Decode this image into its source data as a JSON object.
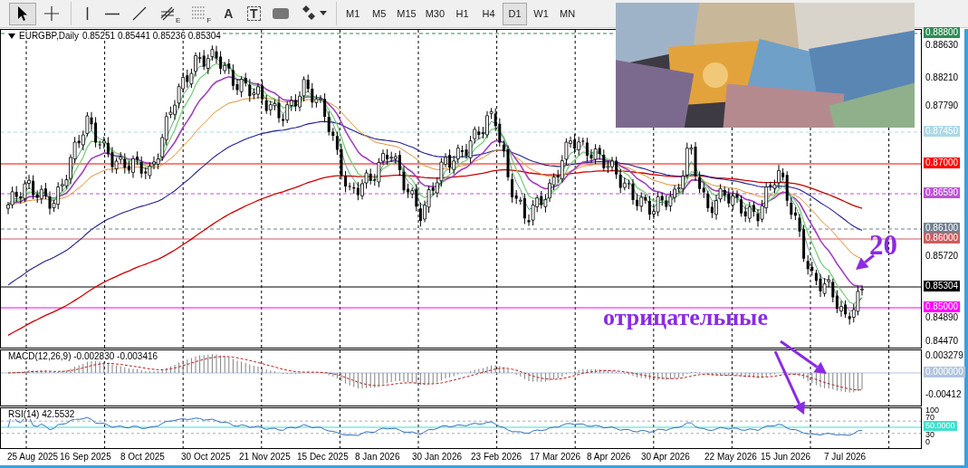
{
  "tools": [
    {
      "kind": "cursor",
      "selected": true
    },
    {
      "kind": "crosshair",
      "selected": false
    },
    {
      "kind": "vertical-line",
      "selected": false
    },
    {
      "kind": "horizontal-line",
      "selected": false
    },
    {
      "kind": "trend-line",
      "selected": false
    },
    {
      "kind": "fibonacci",
      "label": "E",
      "selected": false
    },
    {
      "kind": "fibonacci-levels",
      "label": "F",
      "selected": false
    },
    {
      "kind": "text",
      "label": "A",
      "selected": false
    },
    {
      "kind": "text-label",
      "label": "T",
      "selected": false
    },
    {
      "kind": "rectangle",
      "selected": false
    },
    {
      "kind": "shapes-menu",
      "selected": false
    }
  ],
  "timeframes": [
    {
      "label": "M1",
      "selected": false
    },
    {
      "label": "M5",
      "selected": false
    },
    {
      "label": "M15",
      "selected": false
    },
    {
      "label": "M30",
      "selected": false
    },
    {
      "label": "H1",
      "selected": false
    },
    {
      "label": "H4",
      "selected": false
    },
    {
      "label": "D1",
      "selected": true
    },
    {
      "label": "W1",
      "selected": false
    },
    {
      "label": "MN",
      "selected": false
    }
  ],
  "header": {
    "symbol": "EURGBP,Daily",
    "values": "0.85251 0.85441 0.85236 0.85304"
  },
  "price_axis": [
    {
      "text": "0.88800",
      "kind": "tag",
      "color": "#2e8b57",
      "dashed": true
    },
    {
      "text": "0.88630",
      "kind": "tick"
    },
    {
      "text": "0.88210",
      "kind": "tick"
    },
    {
      "text": "0.87790",
      "kind": "tick"
    },
    {
      "text": "0.87450",
      "kind": "tag",
      "color": "#add8e6",
      "dashed": true
    },
    {
      "text": "0.87000",
      "kind": "tag",
      "color": "#ff0000",
      "dashed": false
    },
    {
      "text": "0.86590",
      "kind": "tag",
      "color": "#ba55d3",
      "dashed": true
    },
    {
      "text": "0.86100",
      "kind": "tag",
      "color": "#708090",
      "dashed": true
    },
    {
      "text": "0.86000",
      "kind": "tag",
      "color": "#cd5c5c",
      "dashed": false
    },
    {
      "text": "0.85720",
      "kind": "tick"
    },
    {
      "text": "0.85304",
      "kind": "tag",
      "color": "#000000",
      "dashed": false
    },
    {
      "text": "0.85000",
      "kind": "tag",
      "color": "#ff00ff",
      "dashed": false
    },
    {
      "text": "0.84890",
      "kind": "tick"
    },
    {
      "text": "0.84470",
      "kind": "tick"
    }
  ],
  "macd": {
    "label": "MACD(12,26,9) -0.002830 -0.003416",
    "axis": [
      {
        "text": "0.003279",
        "kind": "tick"
      },
      {
        "text": "0.000000",
        "kind": "tag",
        "color": "#b0c4de"
      },
      {
        "text": "-0.00412",
        "kind": "tick"
      }
    ]
  },
  "rsi": {
    "label": "RSI(14) 42.5532",
    "axis": [
      {
        "text": "100",
        "kind": "tick"
      },
      {
        "text": "70",
        "kind": "tick"
      },
      {
        "text": "50.0000",
        "kind": "tag",
        "color": "#40e0d0"
      },
      {
        "text": "30",
        "kind": "tick"
      },
      {
        "text": "0",
        "kind": "tick"
      }
    ]
  },
  "dates": [
    "25 Aug 2025",
    "16 Sep 2025",
    "8 Oct 2025",
    "30 Oct 2025",
    "21 Nov 2025",
    "15 Dec 2025",
    "8 Jan 2026",
    "30 Jan 2026",
    "23 Feb 2026",
    "17 Mar 2026",
    "8 Apr 2026",
    "30 Apr 2026",
    "22 May 2026",
    "15 Jun 2026",
    "7 Jul 2026"
  ],
  "annotations": [
    {
      "text": "20"
    },
    {
      "text": "отрицательные"
    }
  ]
}
